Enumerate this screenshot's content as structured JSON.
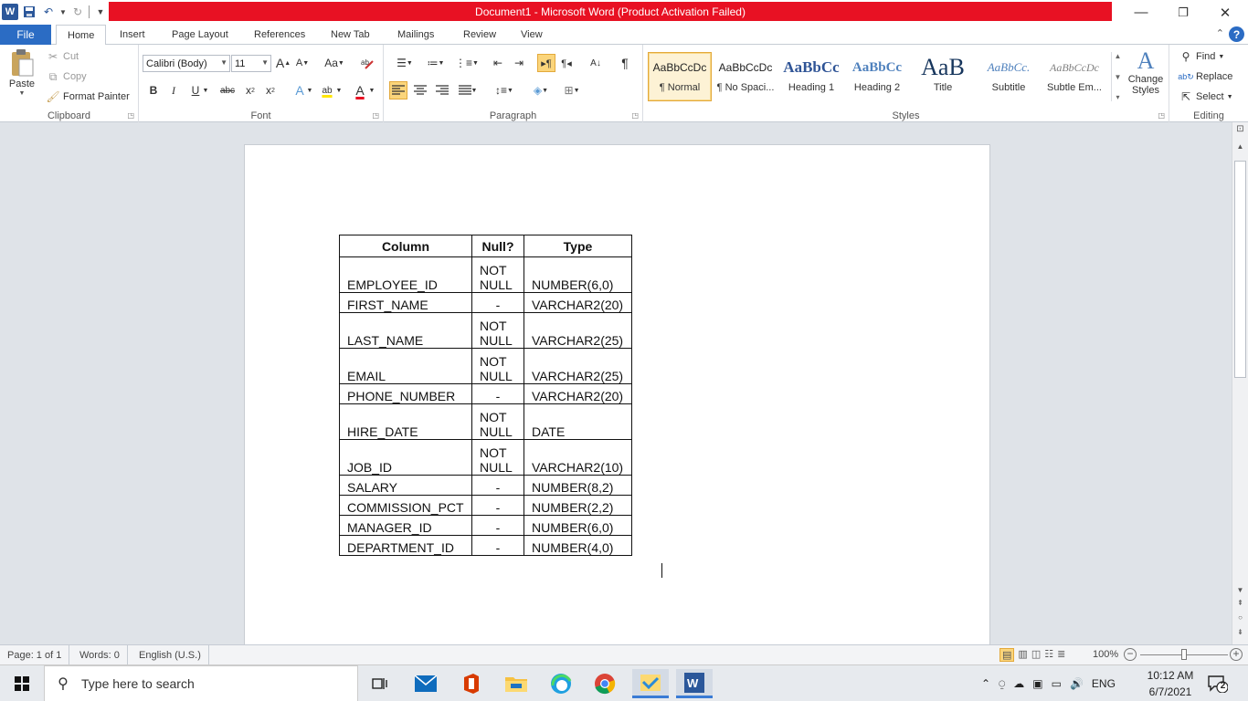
{
  "window": {
    "title": "Document1  -  Microsoft Word (Product Activation Failed)",
    "minimize": "—",
    "restore": "❐",
    "close": "✕"
  },
  "tabs": [
    {
      "label": "File"
    },
    {
      "label": "Home"
    },
    {
      "label": "Insert"
    },
    {
      "label": "Page Layout"
    },
    {
      "label": "References"
    },
    {
      "label": "New Tab"
    },
    {
      "label": "Mailings"
    },
    {
      "label": "Review"
    },
    {
      "label": "View"
    }
  ],
  "help_label": "?",
  "clipboard": {
    "paste": "Paste",
    "cut": "Cut",
    "copy": "Copy",
    "format_painter": "Format Painter",
    "group_label": "Clipboard"
  },
  "font": {
    "name": "Calibri (Body)",
    "size": "11",
    "grow": "A",
    "shrink": "A",
    "case": "Aa",
    "bold": "B",
    "italic": "I",
    "underline": "U",
    "strike": "abc",
    "subscript": "x",
    "superscript": "x",
    "sub_mark": "2",
    "sup_mark": "2",
    "text_effects": "A",
    "highlight": "ab",
    "font_color": "A",
    "group_label": "Font"
  },
  "paragraph": {
    "sort": "A↓",
    "show_marks": "¶",
    "group_label": "Paragraph"
  },
  "styles": {
    "items": [
      {
        "preview": "AaBbCcDc",
        "name": "¶ Normal"
      },
      {
        "preview": "AaBbCcDc",
        "name": "¶ No Spaci..."
      },
      {
        "preview": "AaBbCc",
        "name": "Heading 1"
      },
      {
        "preview": "AaBbCc",
        "name": "Heading 2"
      },
      {
        "preview": "AaB",
        "name": "Title"
      },
      {
        "preview": "AaBbCc.",
        "name": "Subtitle"
      },
      {
        "preview": "AaBbCcDc",
        "name": "Subtle Em..."
      }
    ],
    "change_styles": "Change Styles",
    "group_label": "Styles"
  },
  "editing": {
    "find": "Find",
    "replace": "Replace",
    "select": "Select",
    "group_label": "Editing"
  },
  "document": {
    "table": {
      "headers": [
        "Column",
        "Null?",
        "Type"
      ],
      "rows": [
        {
          "column": "EMPLOYEE_ID",
          "null": "NOT NULL",
          "type": "NUMBER(6,0)"
        },
        {
          "column": "FIRST_NAME",
          "null": "-",
          "type": "VARCHAR2(20)"
        },
        {
          "column": "LAST_NAME",
          "null": "NOT NULL",
          "type": "VARCHAR2(25)"
        },
        {
          "column": "EMAIL",
          "null": "NOT NULL",
          "type": "VARCHAR2(25)"
        },
        {
          "column": "PHONE_NUMBER",
          "null": "-",
          "type": "VARCHAR2(20)"
        },
        {
          "column": "HIRE_DATE",
          "null": "NOT NULL",
          "type": "DATE"
        },
        {
          "column": "JOB_ID",
          "null": "NOT NULL",
          "type": "VARCHAR2(10)"
        },
        {
          "column": "SALARY",
          "null": "-",
          "type": "NUMBER(8,2)"
        },
        {
          "column": "COMMISSION_PCT",
          "null": "-",
          "type": "NUMBER(2,2)"
        },
        {
          "column": "MANAGER_ID",
          "null": "-",
          "type": "NUMBER(6,0)"
        },
        {
          "column": "DEPARTMENT_ID",
          "null": "-",
          "type": "NUMBER(4,0)"
        }
      ]
    }
  },
  "status": {
    "page": "Page: 1 of 1",
    "words": "Words: 0",
    "language": "English (U.S.)",
    "zoom": "100%",
    "zoom_level": 100
  },
  "taskbar": {
    "search_placeholder": "Type here to search",
    "language": "ENG",
    "time": "10:12 AM",
    "date": "6/7/2021",
    "notifications": "2"
  },
  "colors": {
    "title_bar_error": "#e81123",
    "file_tab": "#2b6cc4",
    "word_blue": "#2b579a",
    "selected_style": "#fdf2d5"
  }
}
